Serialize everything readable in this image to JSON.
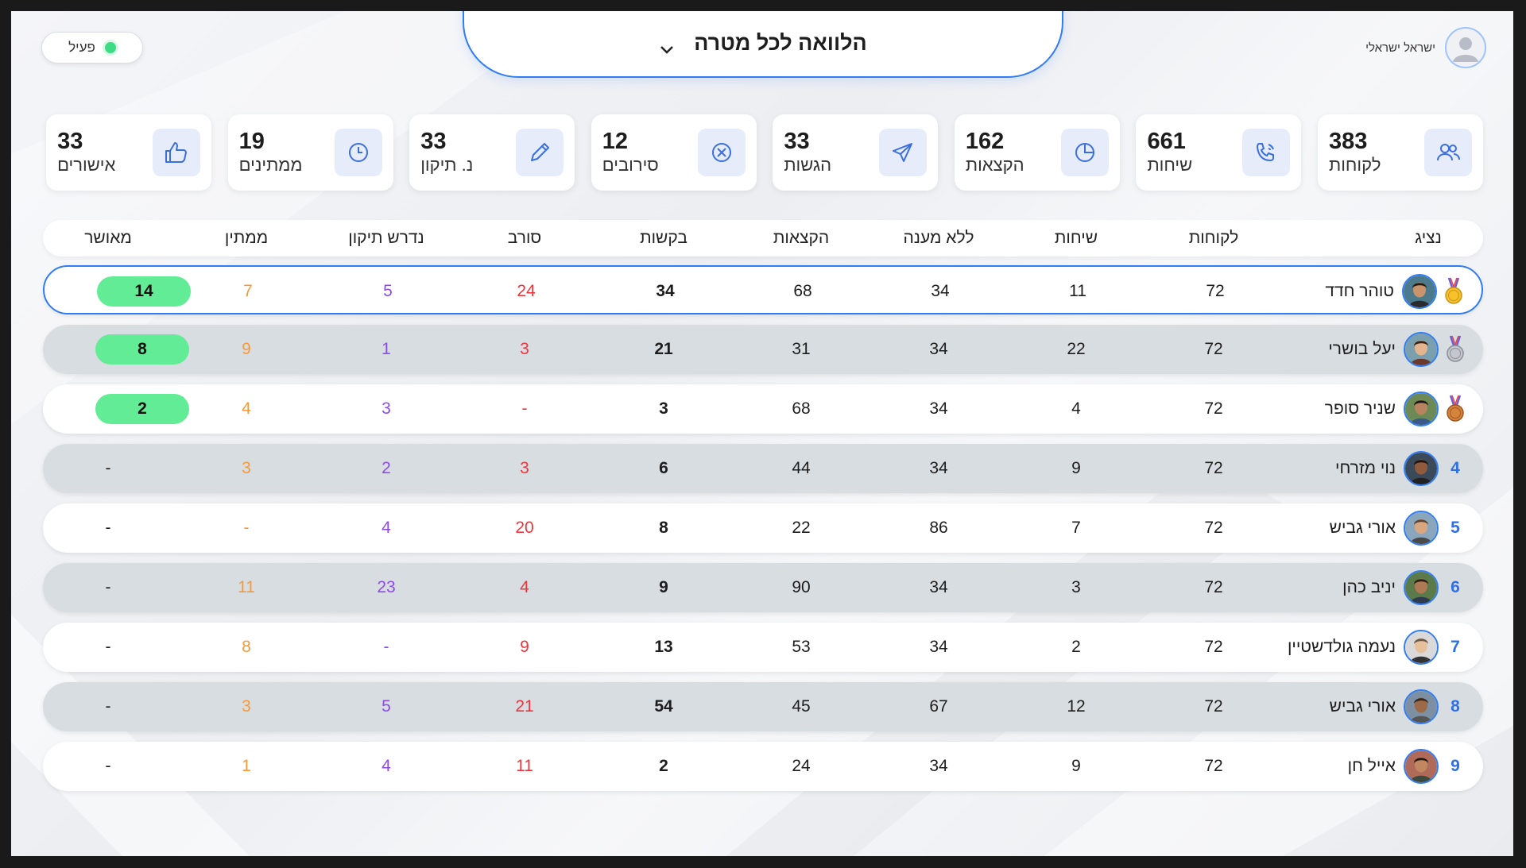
{
  "status": {
    "label": "פעיל",
    "dot_color": "#3ddc84"
  },
  "user": {
    "name": "ישראל ישראלי",
    "icon": "user-avatar-icon"
  },
  "header": {
    "title": "הלוואה לכל מטרה",
    "chevron_icon": "chevron-down-icon"
  },
  "stats": [
    {
      "value": "383",
      "label": "לקוחות",
      "icon": "users-icon"
    },
    {
      "value": "661",
      "label": "שיחות",
      "icon": "phone-icon"
    },
    {
      "value": "162",
      "label": "הקצאות",
      "icon": "pie-chart-icon"
    },
    {
      "value": "33",
      "label": "הגשות",
      "icon": "send-icon"
    },
    {
      "value": "12",
      "label": "סירובים",
      "icon": "x-circle-icon"
    },
    {
      "value": "33",
      "label": "נ. תיקון",
      "icon": "pencil-icon"
    },
    {
      "value": "19",
      "label": "ממתינים",
      "icon": "clock-icon"
    },
    {
      "value": "33",
      "label": "אישורים",
      "icon": "thumbs-up-icon"
    }
  ],
  "table": {
    "headers": {
      "rep": "נציג",
      "customers": "לקוחות",
      "calls": "שיחות",
      "no_answer": "ללא מענה",
      "allocations": "הקצאות",
      "requests": "בקשות",
      "rejected": "סורב",
      "needs_fix": "נדרש תיקון",
      "pending": "ממתין",
      "approved": "מאושר"
    },
    "rows": [
      {
        "rank": "1",
        "medal": "gold",
        "name": "טוהר חדד",
        "customers": "72",
        "calls": "11",
        "no_answer": "34",
        "allocations": "68",
        "requests": "34",
        "rejected": "24",
        "needs_fix": "5",
        "pending": "7",
        "approved": "14"
      },
      {
        "rank": "2",
        "medal": "silver",
        "name": "יעל בושרי",
        "customers": "72",
        "calls": "22",
        "no_answer": "34",
        "allocations": "31",
        "requests": "21",
        "rejected": "3",
        "needs_fix": "1",
        "pending": "9",
        "approved": "8"
      },
      {
        "rank": "3",
        "medal": "bronze",
        "name": "שניר סופר",
        "customers": "72",
        "calls": "4",
        "no_answer": "34",
        "allocations": "68",
        "requests": "3",
        "rejected": "-",
        "needs_fix": "3",
        "pending": "4",
        "approved": "2"
      },
      {
        "rank": "4",
        "medal": "",
        "name": "נוי מזרחי",
        "customers": "72",
        "calls": "9",
        "no_answer": "34",
        "allocations": "44",
        "requests": "6",
        "rejected": "3",
        "needs_fix": "2",
        "pending": "3",
        "approved": "-"
      },
      {
        "rank": "5",
        "medal": "",
        "name": "אורי גביש",
        "customers": "72",
        "calls": "7",
        "no_answer": "86",
        "allocations": "22",
        "requests": "8",
        "rejected": "20",
        "needs_fix": "4",
        "pending": "-",
        "approved": "-"
      },
      {
        "rank": "6",
        "medal": "",
        "name": "יניב כהן",
        "customers": "72",
        "calls": "3",
        "no_answer": "34",
        "allocations": "90",
        "requests": "9",
        "rejected": "4",
        "needs_fix": "23",
        "pending": "11",
        "approved": "-"
      },
      {
        "rank": "7",
        "medal": "",
        "name": "נעמה גולדשטיין",
        "customers": "72",
        "calls": "2",
        "no_answer": "34",
        "allocations": "53",
        "requests": "13",
        "rejected": "9",
        "needs_fix": "-",
        "pending": "8",
        "approved": "-"
      },
      {
        "rank": "8",
        "medal": "",
        "name": "אורי גביש",
        "customers": "72",
        "calls": "12",
        "no_answer": "67",
        "allocations": "45",
        "requests": "54",
        "rejected": "21",
        "needs_fix": "5",
        "pending": "3",
        "approved": "-"
      },
      {
        "rank": "9",
        "medal": "",
        "name": "אייל חן",
        "customers": "72",
        "calls": "9",
        "no_answer": "34",
        "allocations": "24",
        "requests": "2",
        "rejected": "11",
        "needs_fix": "4",
        "pending": "1",
        "approved": "-"
      }
    ]
  },
  "colors": {
    "accent": "#2f7cf6",
    "rejected": "#f0343c",
    "needs_fix": "#8d4bea",
    "pending": "#f59a3a",
    "approved_pill": "#62ec95",
    "rank_number": "#2f6fe8"
  }
}
